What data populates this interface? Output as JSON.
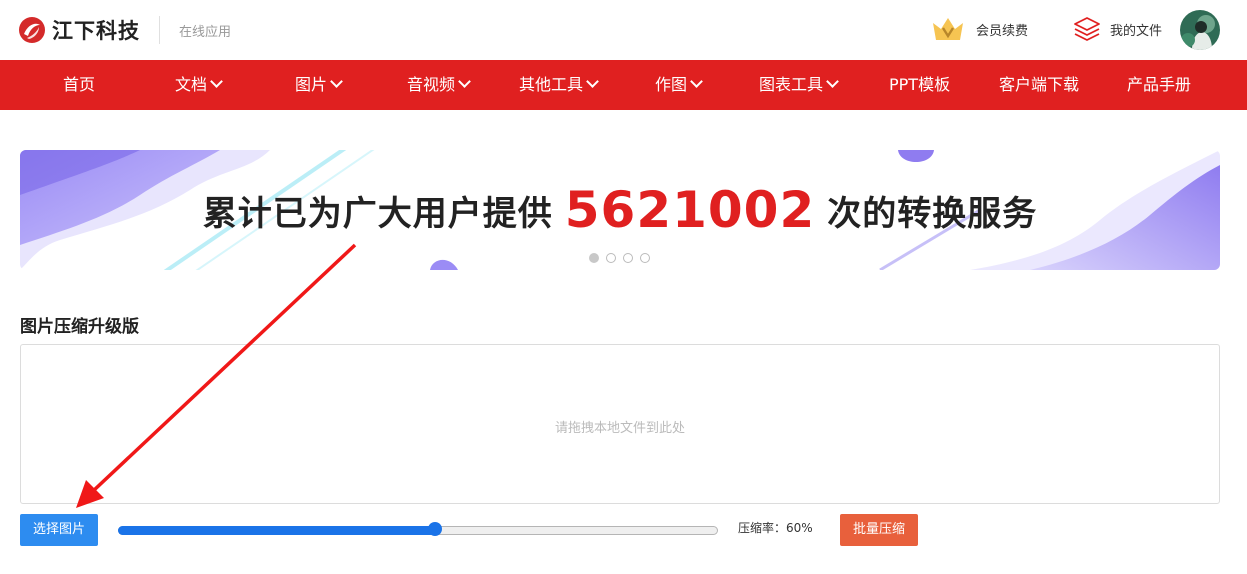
{
  "header": {
    "logo_text": "江下科技",
    "sub_title": "在线应用",
    "vip_label": "会员续费",
    "files_label": "我的文件"
  },
  "nav": {
    "items": [
      {
        "label": "首页",
        "dropdown": false
      },
      {
        "label": "文档",
        "dropdown": true
      },
      {
        "label": "图片",
        "dropdown": true
      },
      {
        "label": "音视频",
        "dropdown": true
      },
      {
        "label": "其他工具",
        "dropdown": true
      },
      {
        "label": "作图",
        "dropdown": true
      },
      {
        "label": "图表工具",
        "dropdown": true
      },
      {
        "label": "PPT模板",
        "dropdown": false
      },
      {
        "label": "客户端下载",
        "dropdown": false
      },
      {
        "label": "产品手册",
        "dropdown": false
      }
    ]
  },
  "banner": {
    "prefix": "累计已为广大用户提供",
    "count": "5621002",
    "suffix": "次的转换服务",
    "slides": 4,
    "active_slide": 1
  },
  "tool": {
    "title": "图片压缩升级版",
    "drop_hint": "请拖拽本地文件到此处",
    "select_button": "选择图片",
    "ratio_label": "压缩率：60%",
    "ratio_value": 0.6,
    "batch_button": "批量压缩"
  },
  "colors": {
    "brand_red": "#e02020",
    "primary_blue": "#2d8cf0",
    "slider_blue": "#1a73e8",
    "batch_orange": "#e8603c",
    "banner_purple": "#8f7cf0"
  },
  "icons": {
    "vip": "crown-icon",
    "files": "layers-icon",
    "nav_dropdown": "chevron-down-icon",
    "annotation": "red-arrow-icon"
  }
}
